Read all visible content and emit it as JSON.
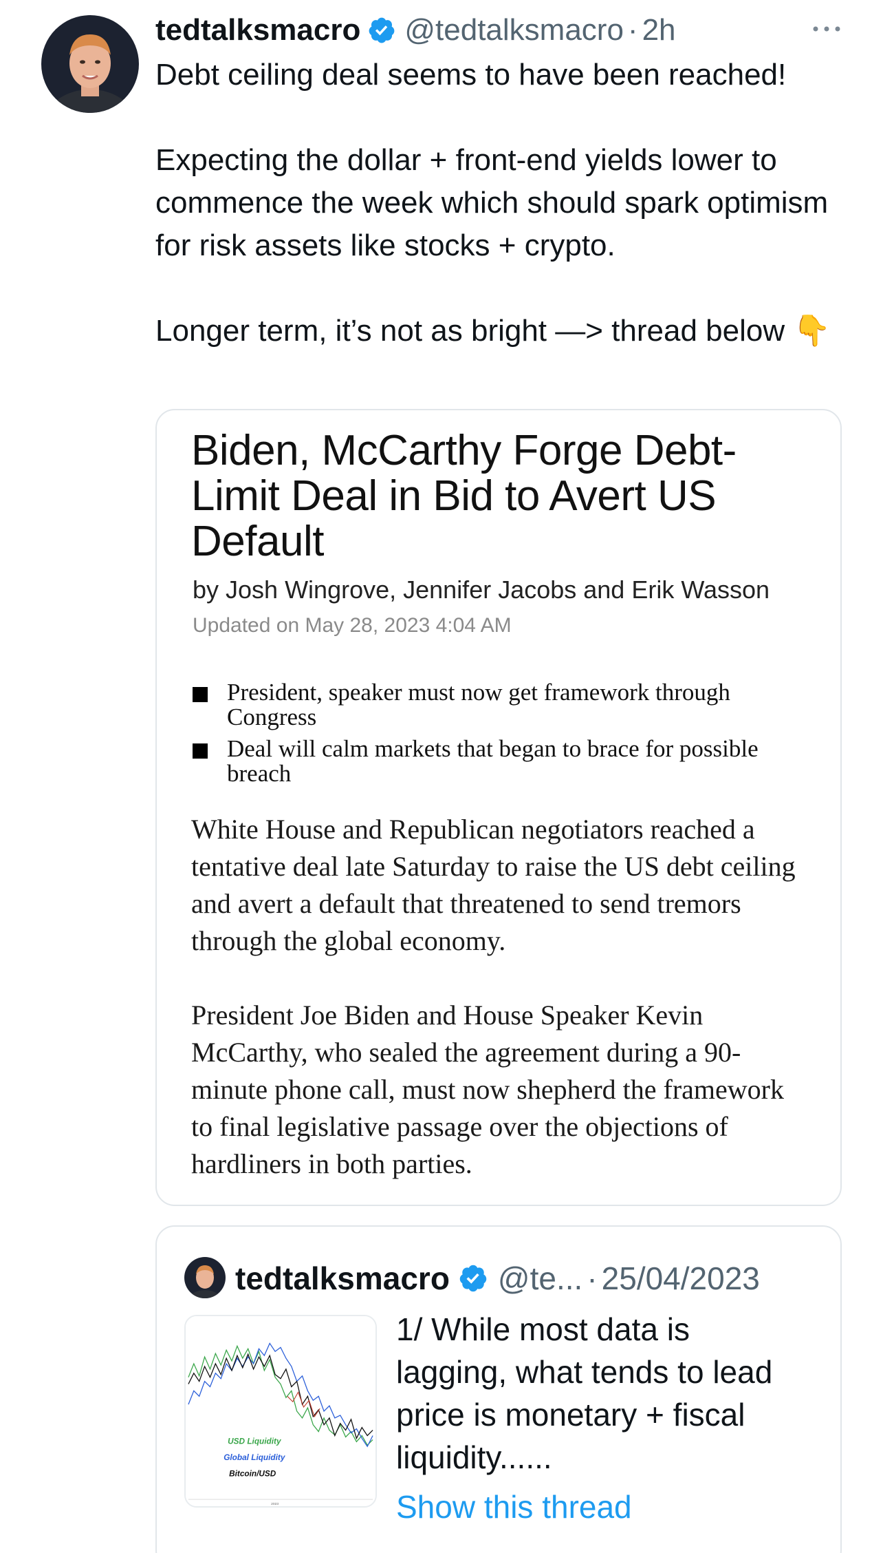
{
  "tweet": {
    "display_name": "tedtalksmacro",
    "handle": "@tedtalksmacro",
    "separator": "·",
    "time": "2h",
    "text": "Debt ceiling deal seems to have been reached!\n\nExpecting the dollar + front-end yields lower to commence the week which should spark optimism for risk assets like stocks + crypto.\n\nLonger term, it’s not as bright —> thread below 👇",
    "icons": {
      "more": "more-icon",
      "verified": "verified-badge-icon",
      "avatar": "avatar"
    }
  },
  "article": {
    "title": "Biden, McCarthy Forge Debt-Limit Deal in Bid to Avert US Default",
    "byline": "by Josh Wingrove, Jennifer Jacobs and Erik Wasson",
    "updated": "Updated on May 28, 2023 4:04 AM",
    "bullets": [
      "President, speaker must now get framework through Congress",
      "Deal will calm markets that began to brace for possible breach"
    ],
    "paragraphs": [
      "White House and Republican negotiators reached a tentative deal late Saturday to raise the US debt ceiling and avert a default that threatened to send tremors through the global economy.",
      "President Joe Biden and House Speaker Kevin McCarthy, who sealed the agreement during a 90-minute phone call, must now shepherd the framework to final legislative passage over the objections of hardliners in both parties."
    ]
  },
  "quoted": {
    "display_name": "tedtalksmacro",
    "handle": "@te...",
    "separator": "·",
    "date": "25/04/2023",
    "text": "1/ While most data is lagging, what tends to lead price is monetary + fiscal liquidity......",
    "link": "Show this thread",
    "thumbnail_legend": [
      "USD Liquidity",
      "Global Liquidity",
      "Bitcoin/USD"
    ],
    "thumbnail_tick": "2023"
  },
  "colors": {
    "text": "#0f1419",
    "secondary": "#536471",
    "link": "#1d9bf0",
    "verified": "#1d9bf0",
    "border": "#e1e6ea",
    "legend_usd": "#3aa64a",
    "legend_global": "#2b5fd9",
    "legend_btc": "#111111"
  }
}
